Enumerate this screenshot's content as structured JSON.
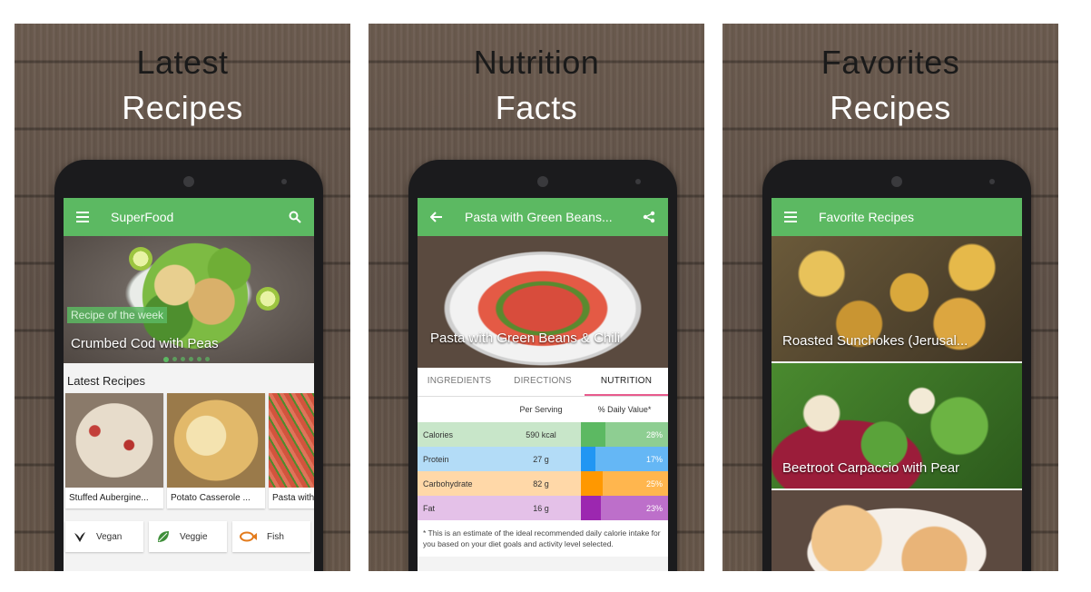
{
  "panels": [
    {
      "caption_line1": "Latest",
      "caption_line2": "Recipes",
      "appbar": {
        "title": "SuperFood",
        "left_icon": "menu-icon",
        "right_icon": "search-icon"
      },
      "hero": {
        "badge": "Recipe of the week",
        "title": "Crumbed Cod with Peas",
        "dots": 6,
        "active_dot": 0
      },
      "section_title": "Latest Recipes",
      "cards": [
        "Stuffed Aubergine...",
        "Potato Casserole ...",
        "Pasta with"
      ],
      "categories": [
        {
          "label": "Vegan",
          "icon": "vegan-sprout-icon"
        },
        {
          "label": "Veggie",
          "icon": "leaf-icon"
        },
        {
          "label": "Fish",
          "icon": "fish-icon"
        }
      ]
    },
    {
      "caption_line1": "Nutrition",
      "caption_line2": "Facts",
      "appbar": {
        "title": "Pasta with Green Beans...",
        "left_icon": "back-arrow-icon",
        "right_icon": "share-icon"
      },
      "hero_title": "Pasta with Green Beans & Chili",
      "tabs": [
        "INGREDIENTS",
        "DIRECTIONS",
        "NUTRITION"
      ],
      "active_tab": 2,
      "table_headers": {
        "serving": "Per Serving",
        "daily": "% Daily Value*"
      },
      "rows": [
        {
          "name": "Calories",
          "serving": "590 kcal",
          "daily": "28%",
          "percent": 28,
          "bg": "#c8e6c9",
          "bar": "#5cb962"
        },
        {
          "name": "Protein",
          "serving": "27 g",
          "daily": "17%",
          "percent": 17,
          "bg": "#b3dcf7",
          "bar": "#2196f3"
        },
        {
          "name": "Carbohydrate",
          "serving": "82 g",
          "daily": "25%",
          "percent": 25,
          "bg": "#ffd8a8",
          "bar": "#ff9800"
        },
        {
          "name": "Fat",
          "serving": "16 g",
          "daily": "23%",
          "percent": 23,
          "bg": "#e4c1e8",
          "bar": "#9c27b0"
        }
      ],
      "footnote": "* This is an estimate of the ideal recommended daily calorie intake for you based on your diet goals and activity level selected."
    },
    {
      "caption_line1": "Favorites",
      "caption_line2": "Recipes",
      "appbar": {
        "title": "Favorite Recipes",
        "left_icon": "menu-icon"
      },
      "favorites": [
        "Roasted Sunchokes (Jerusal...",
        "Beetroot Carpaccio with Pear",
        ""
      ]
    }
  ],
  "colors": {
    "accent": "#5cb962",
    "tab_indicator": "#e85b8d"
  }
}
